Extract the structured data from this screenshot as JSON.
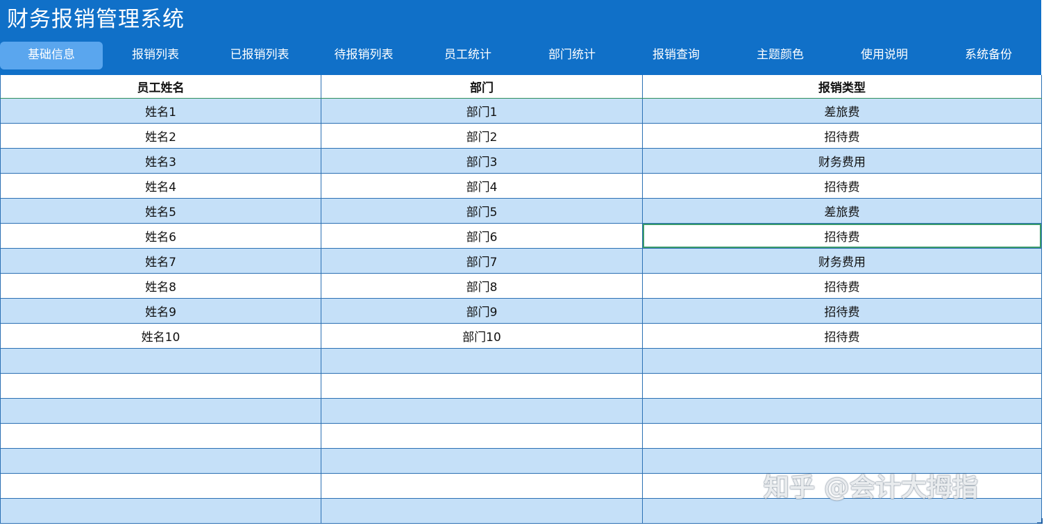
{
  "app": {
    "title": "财务报销管理系统"
  },
  "tabs": [
    {
      "label": "基础信息",
      "active": true
    },
    {
      "label": "报销列表",
      "active": false
    },
    {
      "label": "已报销列表",
      "active": false
    },
    {
      "label": "待报销列表",
      "active": false
    },
    {
      "label": "员工统计",
      "active": false
    },
    {
      "label": "部门统计",
      "active": false
    },
    {
      "label": "报销查询",
      "active": false
    },
    {
      "label": "主题颜色",
      "active": false
    },
    {
      "label": "使用说明",
      "active": false
    },
    {
      "label": "系统备份",
      "active": false
    }
  ],
  "table": {
    "headers": [
      "员工姓名",
      "部门",
      "报销类型"
    ],
    "rows": [
      [
        "姓名1",
        "部门1",
        "差旅费"
      ],
      [
        "姓名2",
        "部门2",
        "招待费"
      ],
      [
        "姓名3",
        "部门3",
        "财务费用"
      ],
      [
        "姓名4",
        "部门4",
        "招待费"
      ],
      [
        "姓名5",
        "部门5",
        "差旅费"
      ],
      [
        "姓名6",
        "部门6",
        "招待费"
      ],
      [
        "姓名7",
        "部门7",
        "财务费用"
      ],
      [
        "姓名8",
        "部门8",
        "招待费"
      ],
      [
        "姓名9",
        "部门9",
        "招待费"
      ],
      [
        "姓名10",
        "部门10",
        "招待费"
      ],
      [
        "",
        "",
        ""
      ],
      [
        "",
        "",
        ""
      ],
      [
        "",
        "",
        ""
      ],
      [
        "",
        "",
        ""
      ],
      [
        "",
        "",
        ""
      ],
      [
        "",
        "",
        ""
      ],
      [
        "",
        "",
        ""
      ]
    ]
  },
  "watermark": {
    "text": "知乎 @会计大拇指"
  },
  "colors": {
    "header_bg": "#1070c8",
    "active_tab": "#5aa6ee",
    "band_row": "#c5e0f8",
    "grid_line": "#2a6fb3",
    "selection": "#3b9a6a"
  }
}
